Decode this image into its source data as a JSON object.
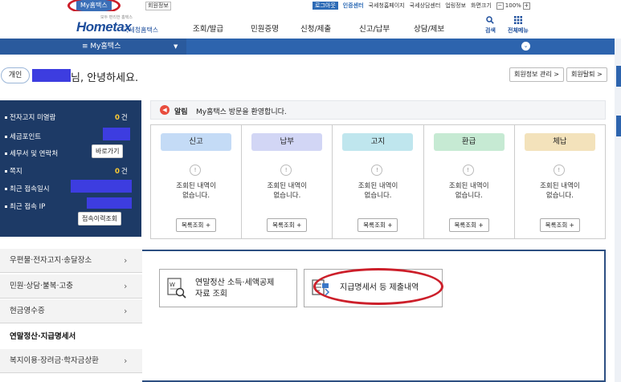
{
  "util": {
    "my_tab": "My홈택스",
    "member_info": "회원정보",
    "login": "로그아웃",
    "auth_center": "인증센터",
    "links": [
      "국세청홈페이지",
      "국세상담센터",
      "업링정보",
      "화면크기"
    ],
    "zoom": "100%",
    "minus": "−",
    "plus": "+"
  },
  "header": {
    "logo_main": "Hometax",
    "logo_sub": "국세청홈택스",
    "logo_tiny": "모두 편리한 홈택스",
    "nav": [
      "조회/발급",
      "민원증명",
      "신청/제출",
      "신고/납부",
      "상담/제보"
    ],
    "search": "검색",
    "all_menu": "전체메뉴"
  },
  "bluebar": {
    "title": "My홈택스"
  },
  "greeting": {
    "badge": "개인",
    "text": "님, 안녕하세요.",
    "member_manage": "회원정보 관리 >",
    "withdraw": "회원탈퇴 >"
  },
  "info": {
    "rows": [
      {
        "label": "전자고지 미열람",
        "value": "0",
        "unit": "건"
      },
      {
        "label": "세금포인트"
      },
      {
        "label": "세무서 및 연락처",
        "button": "바로가기"
      },
      {
        "label": "쪽지",
        "value": "0",
        "unit": "건"
      },
      {
        "label": "최근 접속일시"
      },
      {
        "label": "최근 접속 IP"
      }
    ],
    "history_button": "접속이력조회"
  },
  "notice": {
    "label": "알림",
    "message": "My홈택스 방문을 환영합니다."
  },
  "cards": [
    {
      "title": "신고",
      "color": "#c4dbf6",
      "empty": [
        "조회된 내역이",
        "없습니다."
      ],
      "more": "목록조회 +"
    },
    {
      "title": "납부",
      "color": "#d2d6f5",
      "empty": [
        "조회된 내역이",
        "없습니다."
      ],
      "more": "목록조회 +"
    },
    {
      "title": "고지",
      "color": "#bfe6ee",
      "empty": [
        "조회된 내역이",
        "없습니다."
      ],
      "more": "목록조회 +"
    },
    {
      "title": "환급",
      "color": "#c6ead3",
      "empty": [
        "조회된 내역이",
        "없습니다."
      ],
      "more": "목록조회 +"
    },
    {
      "title": "체납",
      "color": "#f3e2bb",
      "empty": [
        "조회된 내역이",
        "없습니다."
      ],
      "more": "목록조회 +"
    }
  ],
  "leftmenu": [
    "우편물·전자고지·송달장소",
    "민원·상담·불복·고충",
    "현금영수증",
    "연말정산·지급명세서",
    "복지이용·장려금·학자금상환"
  ],
  "tiles": [
    {
      "line1": "연말정산 소득·세액공제",
      "line2": "자료 조회"
    },
    {
      "line1": "지급명세서 등 제출내역",
      "line2": ""
    }
  ]
}
